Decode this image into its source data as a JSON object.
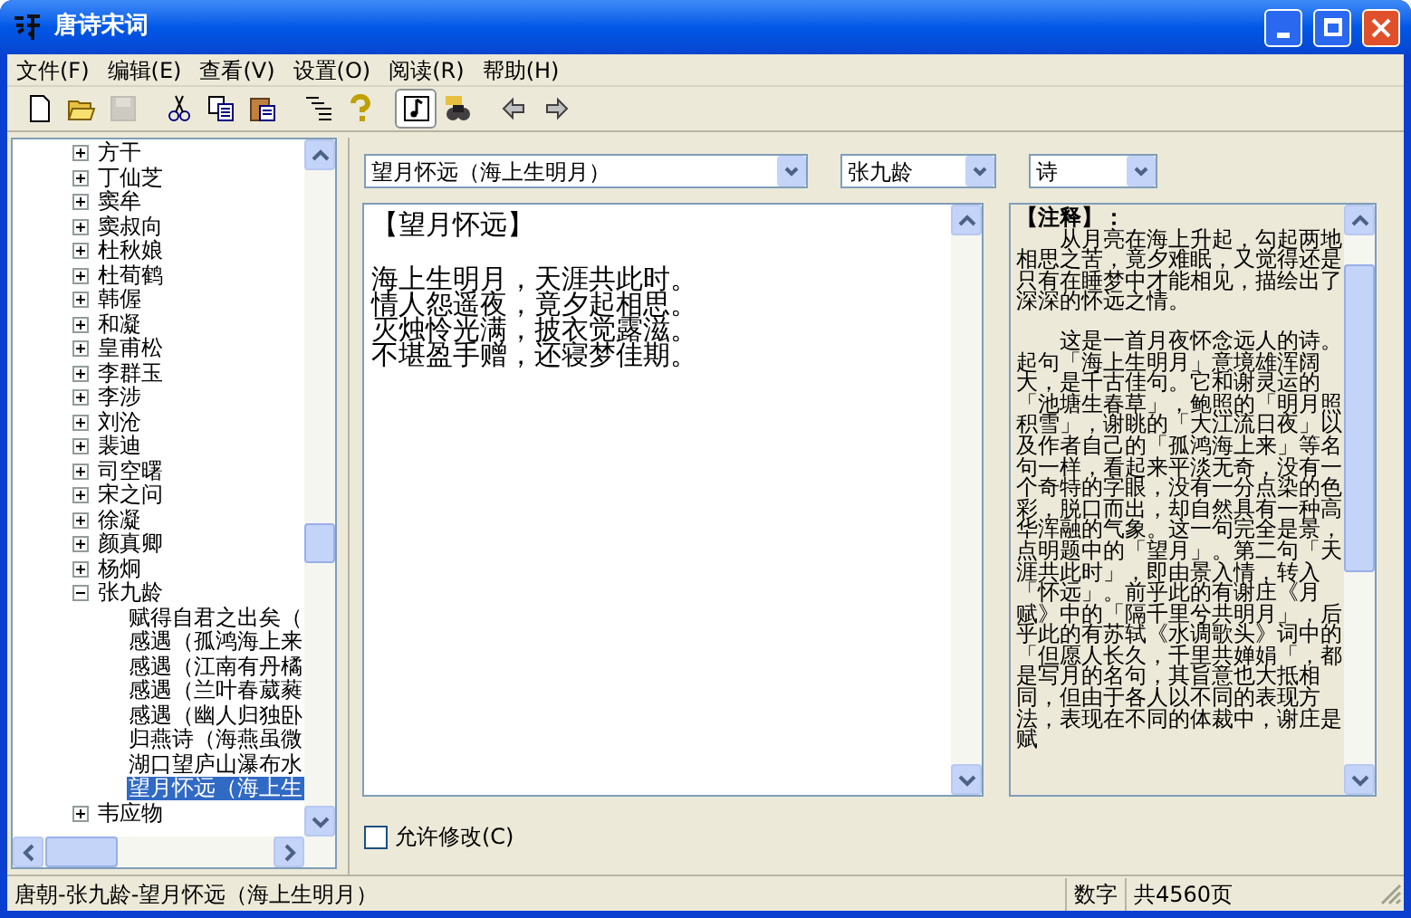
{
  "window": {
    "title": "唐诗宋词"
  },
  "menu": [
    "文件(F)",
    "编辑(E)",
    "查看(V)",
    "设置(O)",
    "阅读(R)",
    "帮助(H)"
  ],
  "toolbar": [
    {
      "kind": "new",
      "disabled": false,
      "pressed": false
    },
    {
      "kind": "open",
      "disabled": false,
      "pressed": false
    },
    {
      "kind": "save",
      "disabled": true,
      "pressed": false
    },
    {
      "kind": "sep"
    },
    {
      "kind": "cut",
      "disabled": false,
      "pressed": false
    },
    {
      "kind": "copy",
      "disabled": false,
      "pressed": false
    },
    {
      "kind": "paste",
      "disabled": false,
      "pressed": false
    },
    {
      "kind": "sep"
    },
    {
      "kind": "list",
      "disabled": false,
      "pressed": false
    },
    {
      "kind": "help",
      "disabled": false,
      "pressed": false
    },
    {
      "kind": "sep"
    },
    {
      "kind": "note",
      "disabled": false,
      "pressed": true
    },
    {
      "kind": "find",
      "disabled": false,
      "pressed": false
    },
    {
      "kind": "sep"
    },
    {
      "kind": "back",
      "disabled": false,
      "pressed": false
    },
    {
      "kind": "forward",
      "disabled": false,
      "pressed": false
    }
  ],
  "tree": [
    {
      "label": "方干",
      "expanded": false,
      "selected": false
    },
    {
      "label": "丁仙芝",
      "expanded": false,
      "selected": false
    },
    {
      "label": "窦牟",
      "expanded": false,
      "selected": false
    },
    {
      "label": "窦叔向",
      "expanded": false,
      "selected": false
    },
    {
      "label": "杜秋娘",
      "expanded": false,
      "selected": false
    },
    {
      "label": "杜荀鹤",
      "expanded": false,
      "selected": false
    },
    {
      "label": "韩偓",
      "expanded": false,
      "selected": false
    },
    {
      "label": "和凝",
      "expanded": false,
      "selected": false
    },
    {
      "label": "皇甫松",
      "expanded": false,
      "selected": false
    },
    {
      "label": "李群玉",
      "expanded": false,
      "selected": false
    },
    {
      "label": "李涉",
      "expanded": false,
      "selected": false
    },
    {
      "label": "刘沧",
      "expanded": false,
      "selected": false
    },
    {
      "label": "裴迪",
      "expanded": false,
      "selected": false
    },
    {
      "label": "司空曙",
      "expanded": false,
      "selected": false
    },
    {
      "label": "宋之问",
      "expanded": false,
      "selected": false
    },
    {
      "label": "徐凝",
      "expanded": false,
      "selected": false
    },
    {
      "label": "颜真卿",
      "expanded": false,
      "selected": false
    },
    {
      "label": "杨炯",
      "expanded": false,
      "selected": false
    },
    {
      "label": "张九龄",
      "expanded": true,
      "selected": false,
      "children": [
        {
          "label": "赋得自君之出矣（",
          "selected": false
        },
        {
          "label": "感遇（孤鸿海上来",
          "selected": false
        },
        {
          "label": "感遇（江南有丹橘",
          "selected": false
        },
        {
          "label": "感遇（兰叶春葳蕤",
          "selected": false
        },
        {
          "label": "感遇（幽人归独卧",
          "selected": false
        },
        {
          "label": "归燕诗（海燕虽微",
          "selected": false
        },
        {
          "label": "湖口望庐山瀑布水",
          "selected": false
        },
        {
          "label": "望月怀远（海上生",
          "selected": true
        }
      ]
    },
    {
      "label": "韦应物",
      "expanded": false,
      "selected": false
    }
  ],
  "selectors": {
    "title": "望月怀远（海上生明月）",
    "author": "张九龄",
    "genre": "诗"
  },
  "poem": {
    "title": "【望月怀远】",
    "lines": [
      "海上生明月，天涯共此时。",
      "情人怨遥夜，竟夕起相思。",
      "灭烛怜光满，披衣觉露滋。",
      "不堪盈手赠，还寝梦佳期。"
    ]
  },
  "notes": {
    "heading": "【注释】：",
    "paragraphs": [
      "　　从月亮在海上升起，勾起两地相思之苦，竟夕难眠，又觉得还是只有在睡梦中才能相见，描绘出了深深的怀远之情。",
      "　　这是一首月夜怀念远人的诗。起句「海上生明月」意境雄浑阔大，是千古佳句。它和谢灵运的「池塘生春草」，鲍照的「明月照积雪」，谢眺的「大江流日夜」以及作者自己的「孤鸿海上来」等名句一样，看起来平淡无奇，没有一个奇特的字眼，没有一分点染的色彩，脱口而出，却自然具有一种高华浑融的气象。这一句完全是景，点明题中的「望月」。第二句「天涯共此时」，即由景入情，转入「怀远」。前乎此的有谢庄《月赋》中的「隔千里兮共明月」，后乎此的有苏轼《水调歌头》词中的「但愿人长久，千里共婵娟「，都是写月的名句，其旨意也大抵相同，但由于各人以不同的表现方法，表现在不同的体裁中，谢庄是赋"
    ]
  },
  "allow_edit": {
    "label": "允许修改(C)",
    "checked": false
  },
  "status_bar": {
    "path": "唐朝-张九龄-望月怀远（海上生明月）",
    "mode": "数字",
    "pages": "共4560页"
  }
}
